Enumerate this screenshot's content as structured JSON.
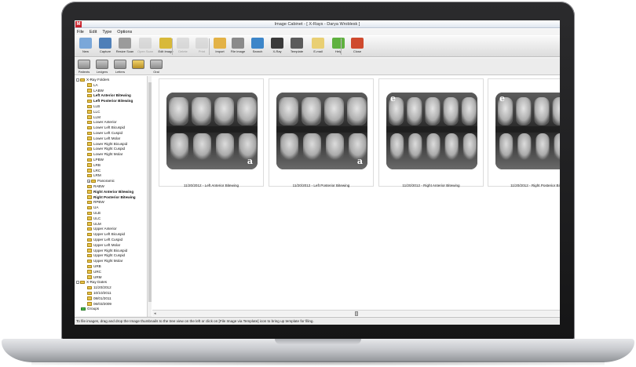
{
  "window": {
    "title": "Image Cabinet - [ X-Rays - Darya Wroblesk ]",
    "app_icon": "M"
  },
  "menu": [
    "File",
    "Edit",
    "Type",
    "Options"
  ],
  "toolbar": [
    {
      "label": "New",
      "icon": "new-icon",
      "color": "#7aa7d9",
      "enabled": true
    },
    {
      "label": "Capture",
      "icon": "capture-icon",
      "color": "#4e7fb8",
      "enabled": true
    },
    {
      "label": "Resize Scan",
      "icon": "scan-icon",
      "color": "#9b9b9b",
      "enabled": true
    },
    {
      "label": "Open Scan",
      "icon": "open-scan-icon",
      "color": "#c6c6c6",
      "enabled": false
    },
    {
      "label": "Edit Image",
      "icon": "edit-icon",
      "color": "#d8b93a",
      "enabled": true
    },
    {
      "label": "Delete",
      "icon": "delete-icon",
      "color": "#c9c9c9",
      "enabled": false
    },
    {
      "label": "Print",
      "icon": "print-icon",
      "color": "#c9c9c9",
      "enabled": false
    },
    {
      "label": "Import",
      "icon": "import-icon",
      "color": "#e3b246",
      "enabled": true
    },
    {
      "label": "File image",
      "icon": "file-image-icon",
      "color": "#8a8a8a",
      "enabled": true
    },
    {
      "label": "Search",
      "icon": "search-icon",
      "color": "#3d86c9",
      "enabled": true
    },
    {
      "label": "X-Ray",
      "icon": "xray-icon",
      "color": "#3a3a3a",
      "enabled": true
    },
    {
      "label": "Template",
      "icon": "template-icon",
      "color": "#5b5b5b",
      "enabled": true
    },
    {
      "label": "E-mail",
      "icon": "email-icon",
      "color": "#e9cf73",
      "enabled": true
    },
    {
      "label": "Help",
      "icon": "help-icon",
      "color": "#5fb13f",
      "enabled": true
    },
    {
      "label": "Close",
      "icon": "close-icon",
      "color": "#cf4a2e",
      "enabled": true
    }
  ],
  "modes": [
    {
      "label": "Patients",
      "icon": "patients-icon",
      "selected": false
    },
    {
      "label": "Ledgers",
      "icon": "ledgers-icon",
      "selected": false
    },
    {
      "label": "Letters",
      "icon": "letters-icon",
      "selected": false
    },
    {
      "label": "",
      "icon": "folder-icon",
      "selected": true
    },
    {
      "label": "Oral",
      "icon": "oral-icon",
      "selected": false
    }
  ],
  "tree": [
    {
      "label": "X-Ray Folders",
      "depth": 0,
      "expander": "-",
      "bold": false,
      "folder": "yellow"
    },
    {
      "label": "LA",
      "depth": 1,
      "bold": false,
      "folder": "yellow"
    },
    {
      "label": "LABW",
      "depth": 1,
      "bold": false,
      "folder": "yellow"
    },
    {
      "label": "Left Anterior Bitewing",
      "depth": 1,
      "bold": true,
      "folder": "yellow"
    },
    {
      "label": "Left Posterior Bitewing",
      "depth": 1,
      "bold": true,
      "folder": "yellow"
    },
    {
      "label": "LLB",
      "depth": 1,
      "bold": false,
      "folder": "yellow"
    },
    {
      "label": "LLC",
      "depth": 1,
      "bold": false,
      "folder": "yellow"
    },
    {
      "label": "LLM",
      "depth": 1,
      "bold": false,
      "folder": "yellow"
    },
    {
      "label": "Lower Anterior",
      "depth": 1,
      "bold": false,
      "folder": "yellow"
    },
    {
      "label": "Lower Left Bicuspid",
      "depth": 1,
      "bold": false,
      "folder": "yellow"
    },
    {
      "label": "Lower Left Cuspid",
      "depth": 1,
      "bold": false,
      "folder": "yellow"
    },
    {
      "label": "Lower Left Molar",
      "depth": 1,
      "bold": false,
      "folder": "yellow"
    },
    {
      "label": "Lower Right Bicuspid",
      "depth": 1,
      "bold": false,
      "folder": "yellow"
    },
    {
      "label": "Lower Right Cuspid",
      "depth": 1,
      "bold": false,
      "folder": "yellow"
    },
    {
      "label": "Lower Right Molar",
      "depth": 1,
      "bold": false,
      "folder": "yellow"
    },
    {
      "label": "LPBW",
      "depth": 1,
      "bold": false,
      "folder": "yellow"
    },
    {
      "label": "LRB",
      "depth": 1,
      "bold": false,
      "folder": "yellow"
    },
    {
      "label": "LRC",
      "depth": 1,
      "bold": false,
      "folder": "yellow"
    },
    {
      "label": "LRM",
      "depth": 1,
      "bold": false,
      "folder": "yellow"
    },
    {
      "label": "Panoramic",
      "depth": 1,
      "expander": "+",
      "bold": false,
      "folder": "yellow"
    },
    {
      "label": "RABW",
      "depth": 1,
      "bold": false,
      "folder": "yellow"
    },
    {
      "label": "Right Anterior Bitewing",
      "depth": 1,
      "bold": true,
      "folder": "yellow"
    },
    {
      "label": "Right Posterior Bitewing",
      "depth": 1,
      "bold": true,
      "folder": "yellow"
    },
    {
      "label": "RPBW",
      "depth": 1,
      "bold": false,
      "folder": "yellow"
    },
    {
      "label": "UA",
      "depth": 1,
      "bold": false,
      "folder": "yellow"
    },
    {
      "label": "ULB",
      "depth": 1,
      "bold": false,
      "folder": "yellow"
    },
    {
      "label": "ULC",
      "depth": 1,
      "bold": false,
      "folder": "yellow"
    },
    {
      "label": "ULM",
      "depth": 1,
      "bold": false,
      "folder": "yellow"
    },
    {
      "label": "Upper Anterior",
      "depth": 1,
      "bold": false,
      "folder": "yellow"
    },
    {
      "label": "Upper Left Bicuspid",
      "depth": 1,
      "bold": false,
      "folder": "yellow"
    },
    {
      "label": "Upper Left Cuspid",
      "depth": 1,
      "bold": false,
      "folder": "yellow"
    },
    {
      "label": "Upper Left Molar",
      "depth": 1,
      "bold": false,
      "folder": "yellow"
    },
    {
      "label": "Upper Right Bicuspid",
      "depth": 1,
      "bold": false,
      "folder": "yellow"
    },
    {
      "label": "Upper Right Cuspid",
      "depth": 1,
      "bold": false,
      "folder": "yellow"
    },
    {
      "label": "Upper Right Molar",
      "depth": 1,
      "bold": false,
      "folder": "yellow"
    },
    {
      "label": "URB",
      "depth": 1,
      "bold": false,
      "folder": "yellow"
    },
    {
      "label": "URC",
      "depth": 1,
      "bold": false,
      "folder": "yellow"
    },
    {
      "label": "URM",
      "depth": 1,
      "bold": false,
      "folder": "yellow"
    },
    {
      "label": "X-Ray Dates",
      "depth": 0,
      "expander": "-",
      "bold": false,
      "folder": "yellow"
    },
    {
      "label": "11/20/2012",
      "depth": 1,
      "bold": false,
      "folder": "yellow"
    },
    {
      "label": "10/10/2011",
      "depth": 1,
      "bold": false,
      "folder": "yellow"
    },
    {
      "label": "08/01/2011",
      "depth": 1,
      "bold": false,
      "folder": "yellow"
    },
    {
      "label": "06/03/2009",
      "depth": 1,
      "bold": false,
      "folder": "yellow"
    },
    {
      "label": "Groups",
      "depth": 0,
      "bold": false,
      "folder": "green"
    }
  ],
  "thumbnails": [
    {
      "caption": "11/20/2012 - Left Anterior Bitewing",
      "badge": "a",
      "badge_pos": "bottom-right"
    },
    {
      "caption": "11/20/2012 - Left Posterior Bitewing",
      "badge": "a",
      "badge_pos": "bottom-right"
    },
    {
      "caption": "11/20/2012 - Right Anterior Bitewing",
      "badge": "e",
      "badge_pos": "top-left"
    },
    {
      "caption": "11/20/2012 - Right Posterior Bitewing",
      "badge": "e",
      "badge_pos": "top-left"
    }
  ],
  "status": "To file images, drag and drop the Image thumbnails to the tree view on the left or click on [File Image via Template] icon to bring up template for filing."
}
